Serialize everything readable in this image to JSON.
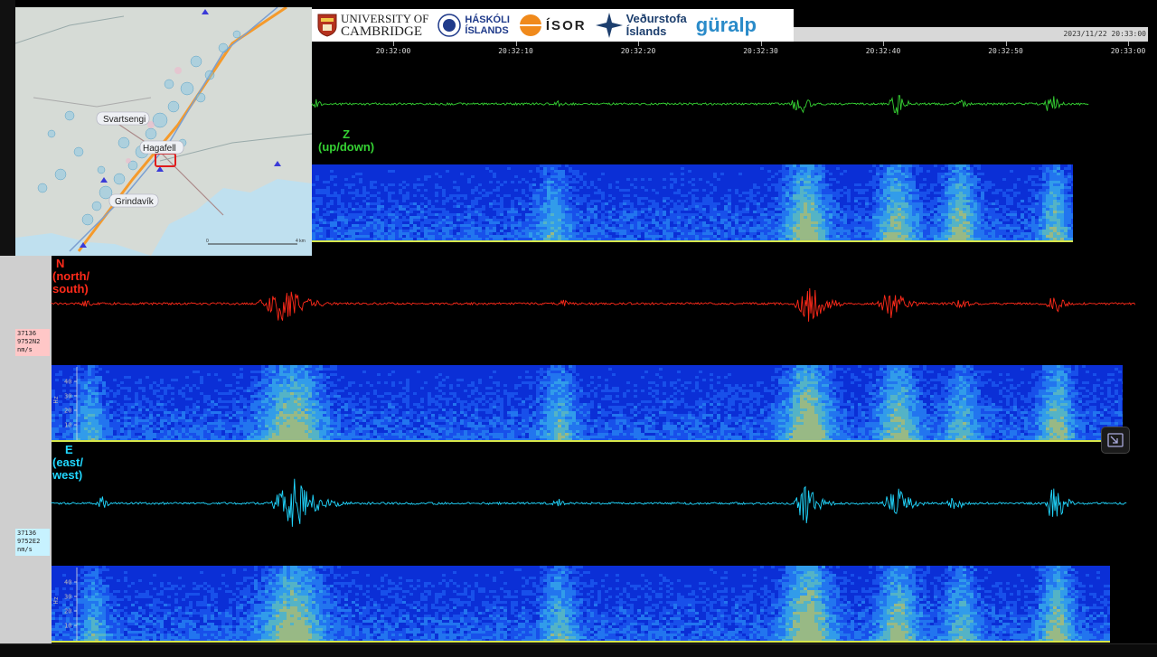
{
  "header": {
    "timestamp": "2023/11/22 20:33:00",
    "time_ticks": [
      "20:32:00",
      "20:32:10",
      "20:32:20",
      "20:32:30",
      "20:32:40",
      "20:32:50",
      "20:33:00"
    ]
  },
  "logos": {
    "cambridge_line1": "UNIVERSITY OF",
    "cambridge_line2": "CAMBRIDGE",
    "haskoli_line1": "HÁSKÓLI",
    "haskoli_line2": "ÍSLANDS",
    "isor": "ÍSOR",
    "vedur_line1": "Veðurstofa",
    "vedur_line2": "Íslands",
    "guralp": "güralp"
  },
  "map": {
    "place_svartsengi": "Svartsengi",
    "place_hagafell": "Hagafell",
    "place_grindavik": "Grindavík",
    "scale_start": "0",
    "scale_end": "4 km"
  },
  "channels": {
    "z": {
      "line1": "Z",
      "line2": "(up/down)",
      "color": "#35d133"
    },
    "n": {
      "line1": "N",
      "line2": "(north/",
      "line3": "south)",
      "color": "#ff2a1a",
      "id1": "37136",
      "id2": "9752N2",
      "unit": "nm/s"
    },
    "e": {
      "line1": "E",
      "line2": "(east/",
      "line3": "west)",
      "color": "#21d7ff",
      "id1": "37136",
      "id2": "9752E2",
      "unit": "nm/s"
    }
  },
  "spectrogram_axis": {
    "unit": "Hz",
    "ticks": [
      "40",
      "30",
      "20",
      "10"
    ]
  },
  "icons": {
    "resize": "resize-icon"
  }
}
